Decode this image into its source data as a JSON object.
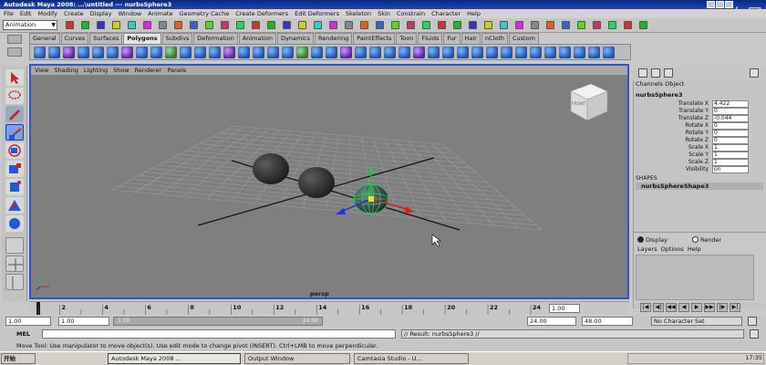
{
  "window": {
    "title": "Autodesk Maya 2008: ...\\untitled     ---     nurbsSphere3",
    "watermark": "火星"
  },
  "menubar": [
    "File",
    "Edit",
    "Modify",
    "Create",
    "Display",
    "Window",
    "Animate",
    "Geometry Cache",
    "Create Deformers",
    "Edit Deformers",
    "Skeleton",
    "Skin",
    "Constrain",
    "Character",
    "Help"
  ],
  "statusline": {
    "mode": "Animation"
  },
  "shelf_tabs": [
    {
      "label": "General",
      "active": false
    },
    {
      "label": "Curves",
      "active": false
    },
    {
      "label": "Surfaces",
      "active": false
    },
    {
      "label": "Polygons",
      "active": true
    },
    {
      "label": "Subdivs",
      "active": false
    },
    {
      "label": "Deformation",
      "active": false
    },
    {
      "label": "Animation",
      "active": false
    },
    {
      "label": "Dynamics",
      "active": false
    },
    {
      "label": "Rendering",
      "active": false
    },
    {
      "label": "PaintEffects",
      "active": false
    },
    {
      "label": "Toon",
      "active": false
    },
    {
      "label": "Fluids",
      "active": false
    },
    {
      "label": "Fur",
      "active": false
    },
    {
      "label": "Hair",
      "active": false
    },
    {
      "label": "nCloth",
      "active": false
    },
    {
      "label": "Custom",
      "active": false
    }
  ],
  "viewport": {
    "menu": [
      "View",
      "Shading",
      "Lighting",
      "Show",
      "Renderer",
      "Panels"
    ],
    "camera": "persp",
    "viewcube_label": "FRONT"
  },
  "channel_box": {
    "menu": [
      "Channels",
      "Object"
    ],
    "node": "nurbsSphere3",
    "attributes": [
      {
        "label": "Translate X",
        "value": "4.422"
      },
      {
        "label": "Translate Y",
        "value": "0"
      },
      {
        "label": "Translate Z",
        "value": "-0.044"
      },
      {
        "label": "Rotate X",
        "value": "0"
      },
      {
        "label": "Rotate Y",
        "value": "0"
      },
      {
        "label": "Rotate Z",
        "value": "0"
      },
      {
        "label": "Scale X",
        "value": "1"
      },
      {
        "label": "Scale Y",
        "value": "1"
      },
      {
        "label": "Scale Z",
        "value": "1"
      },
      {
        "label": "Visibility",
        "value": "on"
      }
    ],
    "shapes_header": "SHAPES",
    "shape": "nurbsSphereShape3"
  },
  "layer_editor": {
    "radio_display": "Display",
    "radio_render": "Render",
    "menu": [
      "Layers",
      "Options",
      "Help"
    ]
  },
  "timeslider": {
    "ticks": [
      "2",
      "4",
      "6",
      "8",
      "10",
      "12",
      "14",
      "16",
      "18",
      "20",
      "22",
      "24"
    ],
    "current_frame": "1.00",
    "playback_buttons": [
      "|◀",
      "◀|",
      "◀◀",
      "◀",
      "▶",
      "▶▶",
      "|▶",
      "▶|"
    ]
  },
  "rangeslider": {
    "start_time": "1.00",
    "playback_start": "1.00",
    "range_start_label": "1.00",
    "range_end_label": "24.00",
    "playback_end": "24.00",
    "end_time": "48.00",
    "character_set": "No Character Set"
  },
  "commandline": {
    "mel_label": "MEL",
    "result": "// Result: nurbsSphere3 //"
  },
  "helpline": "Move Tool: Use manipulator to move object(s). Use edit mode to change pivot (INSERT).  Ctrl+LMB to move perpendicular.",
  "taskbar": {
    "start": "开始",
    "tasks": [
      {
        "label": "Autodesk Maya 2008 ...",
        "active": true
      },
      {
        "label": "Output Window",
        "active": false
      },
      {
        "label": "Camtasia Studio - U...",
        "active": false
      }
    ],
    "clock": "17:35"
  },
  "colors": {
    "viewport_border": "#2e56c8",
    "selected_wireframe": "#39c27a",
    "titlebar": "#1a47b8"
  }
}
